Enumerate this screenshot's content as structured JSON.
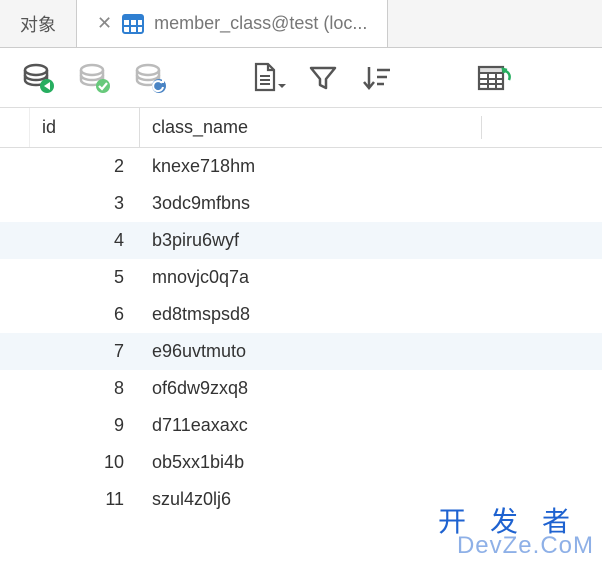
{
  "tabs": {
    "inactive_label": "对象",
    "active_label": "member_class@test (loc..."
  },
  "columns": {
    "id": "id",
    "class_name": "class_name"
  },
  "rows": [
    {
      "id": "2",
      "class_name": "knexe718hm"
    },
    {
      "id": "3",
      "class_name": "3odc9mfbns"
    },
    {
      "id": "4",
      "class_name": "b3piru6wyf"
    },
    {
      "id": "5",
      "class_name": "mnovjc0q7a"
    },
    {
      "id": "6",
      "class_name": "ed8tmspsd8"
    },
    {
      "id": "7",
      "class_name": "e96uvtmuto"
    },
    {
      "id": "8",
      "class_name": "of6dw9zxq8"
    },
    {
      "id": "9",
      "class_name": "d711eaxaxc"
    },
    {
      "id": "10",
      "class_name": "ob5xx1bi4b"
    },
    {
      "id": "11",
      "class_name": "szul4z0lj6"
    }
  ],
  "toolbar": {
    "run": "run-query",
    "commit": "commit",
    "rollback": "rollback",
    "export": "export",
    "filter": "filter",
    "sort": "sort",
    "import": "import"
  },
  "watermark": {
    "cn": "开发者",
    "en": "DevZe.CoM"
  },
  "colors": {
    "accent": "#27ae60",
    "icon": "#555",
    "selected_row": "#f2f7fb"
  }
}
